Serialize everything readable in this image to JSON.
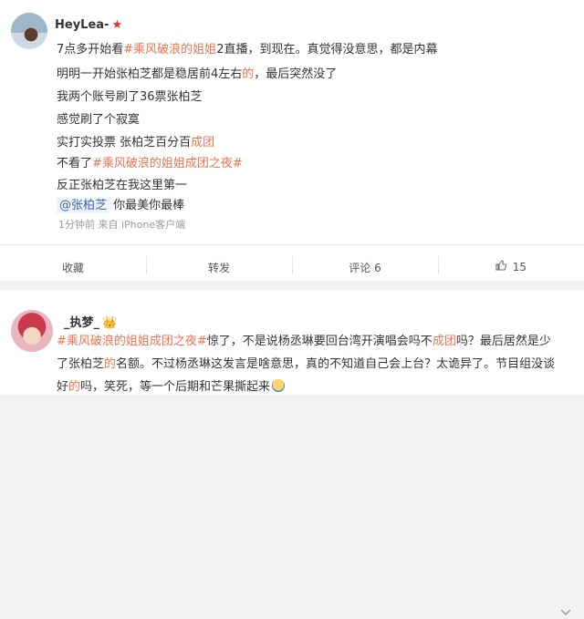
{
  "post": {
    "username": "HeyLea-",
    "badge": "★",
    "lines": [
      [
        "7点多开始看",
        "#乘风破浪的姐姐",
        "2直播，到现在。真觉得没意思，都是内幕"
      ],
      [
        "明明一开始张柏芝都是稳居前4左右",
        "的",
        "，最后突然没了"
      ],
      [
        "我两个账号刷了36票张柏芝"
      ],
      [
        "感觉刷了个寂寞"
      ],
      [
        "实打实投票 张柏芝百分百",
        "成团"
      ],
      [
        "不看了",
        "#乘风破浪的姐姐成团之夜#"
      ],
      [
        "反正张柏芝在我这里第一"
      ],
      [
        "@张柏芝",
        " 你最美你最棒"
      ]
    ],
    "meta": "1分钟前  来自 iPhone客户端",
    "actions": {
      "favorite": "收藏",
      "repost": "转发",
      "comment": "评论 6",
      "like_count": "15"
    }
  },
  "comment": {
    "username": "_执梦_",
    "badge": "👑",
    "lines": [
      [
        "#乘风破浪的姐姐成团之夜#",
        "惊了，不是说杨丞琳要回台湾开演唱会吗不",
        "成团",
        "吗？最后居然是少"
      ],
      [
        "了张柏芝",
        "的",
        "名额。不过杨丞琳这发言是啥意思，",
        "真",
        "的不知道自己会上台？太诡异了。节目组没谈"
      ],
      [
        "好",
        "的",
        "吗，笑死，等一个后期和芒果撕起来"
      ]
    ]
  },
  "icons": {
    "favorite": "star-icon",
    "repost": "repost-icon",
    "comment": "comment-icon",
    "like": "thumbs-up-icon",
    "more": "chevron-down-icon"
  },
  "colors": {
    "topic": "#eb7350",
    "mention_bg": "#eef3fb"
  }
}
